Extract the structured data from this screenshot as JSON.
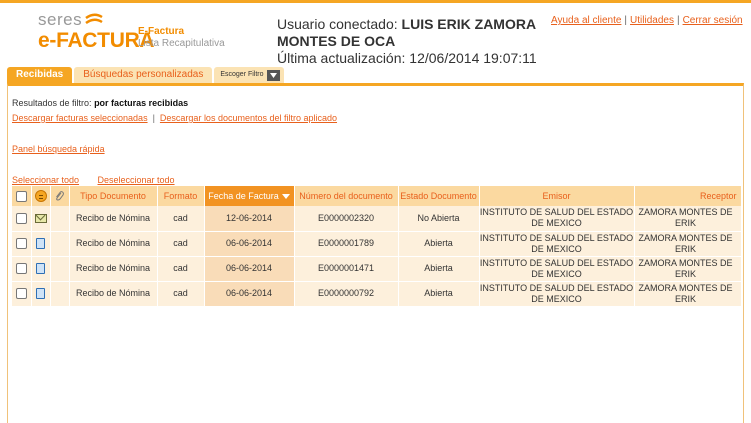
{
  "brand": {
    "top": "seres",
    "main": "e-FACTURA",
    "product": "E-Factura",
    "section": "Lista Recapitulativa",
    "accent": "#f28c00"
  },
  "user": {
    "label": "Usuario conectado:",
    "name": "LUIS ERIK ZAMORA MONTES DE OCA",
    "update_label": "Última actualización:",
    "update_value": "12/06/2014 19:07:11"
  },
  "toplinks": [
    "Ayuda al cliente",
    "Utilidades",
    "Cerrar sesión"
  ],
  "tabs": {
    "active": "Recibidas",
    "second": "Búsquedas personalizadas",
    "filter": "Escoger Filtro"
  },
  "filter": {
    "label": "Resultados de filtro:",
    "value": "por facturas recibidas"
  },
  "actions": {
    "download_selected": "Descargar facturas seleccionadas",
    "download_filter": "Descargar los documentos del filtro aplicado",
    "quick_search": "Panel búsqueda rápida",
    "select_all": "Seleccionar todo",
    "deselect_all": "Deseleccionar todo"
  },
  "table": {
    "headers": {
      "tipo": "Tipo Documento",
      "formato": "Formato",
      "fecha": "Fecha de Factura",
      "numero": "Número del documento",
      "estado": "Estado Documento",
      "emisor": "Emisor",
      "receptor": "Receptor"
    },
    "rows": [
      {
        "icon": "envelope-icon",
        "tipo": "Recibo de Nómina",
        "formato": "cad",
        "fecha": "12-06-2014",
        "numero": "E0000002320",
        "estado": "No Abierta",
        "emisor": "INSTITUTO DE SALUD DEL ESTADO DE MEXICO",
        "receptor": "ZAMORA MONTES DE ERIK"
      },
      {
        "icon": "document-icon",
        "tipo": "Recibo de Nómina",
        "formato": "cad",
        "fecha": "06-06-2014",
        "numero": "E0000001789",
        "estado": "Abierta",
        "emisor": "INSTITUTO DE SALUD DEL ESTADO DE MEXICO",
        "receptor": "ZAMORA MONTES DE ERIK"
      },
      {
        "icon": "document-icon",
        "tipo": "Recibo de Nómina",
        "formato": "cad",
        "fecha": "06-06-2014",
        "numero": "E0000001471",
        "estado": "Abierta",
        "emisor": "INSTITUTO DE SALUD DEL ESTADO DE MEXICO",
        "receptor": "ZAMORA MONTES DE ERIK"
      },
      {
        "icon": "document-icon",
        "tipo": "Recibo de Nómina",
        "formato": "cad",
        "fecha": "06-06-2014",
        "numero": "E0000000792",
        "estado": "Abierta",
        "emisor": "INSTITUTO DE SALUD DEL ESTADO DE MEXICO",
        "receptor": "ZAMORA MONTES DE ERIK"
      }
    ]
  }
}
